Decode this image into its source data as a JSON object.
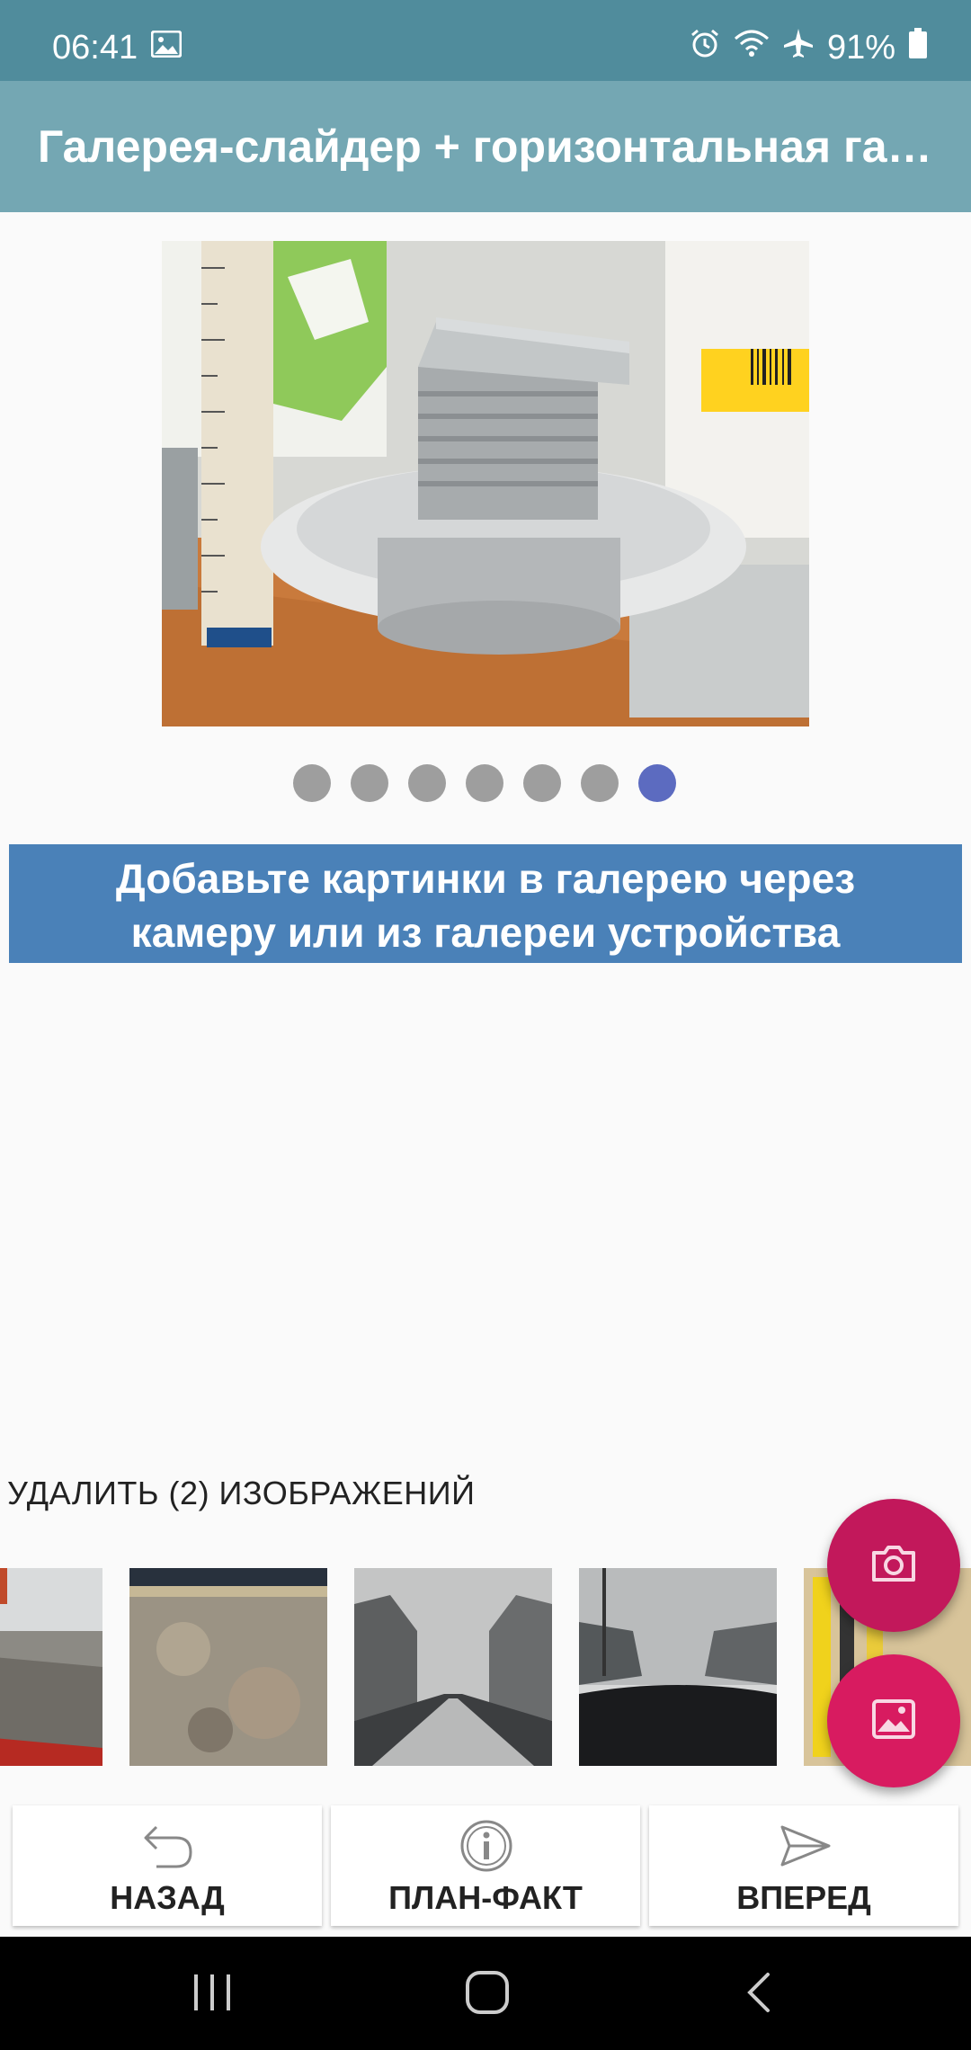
{
  "status_bar": {
    "time": "06:41",
    "battery": "91%",
    "icons": [
      "image-icon",
      "alarm-icon",
      "wifi-icon",
      "airplane-icon",
      "battery-icon"
    ]
  },
  "app_bar": {
    "title": "Галерея-слайдер + горизонтальная галерея"
  },
  "slider": {
    "image": "drain-fitting-with-ruler-photo",
    "dots_total": 7,
    "active_index": 6,
    "colors": {
      "inactive": "#9e9e9e",
      "active": "#5c6bc0"
    }
  },
  "banner": {
    "line1": "Добавьте картинки в галерею через",
    "line2": "камеру или из галереи устройства",
    "color": "#4a81b8"
  },
  "gallery": {
    "delete_label": "УДАЛИТЬ (2) ИЗОБРАЖЕНИЙ",
    "thumbnails": [
      "concrete-edge-photo",
      "asphalt-surface-photo",
      "snowy-road-photo",
      "car-dashboard-winter-road-photo",
      "tools-on-pegboard-photo"
    ]
  },
  "fabs": {
    "camera": "camera-icon",
    "gallery": "gallery-icon",
    "colors": {
      "camera": "#c2185b",
      "gallery": "#d81b60"
    }
  },
  "bottom_nav": {
    "back": "НАЗАД",
    "plan_fact": "ПЛАН-ФАКТ",
    "forward": "ВПЕРЕД"
  },
  "colors": {
    "status_bar": "#508c9c",
    "app_bar": "#74a7b3"
  }
}
